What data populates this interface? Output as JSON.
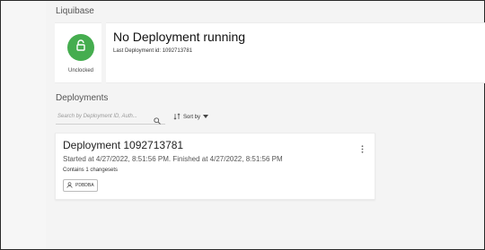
{
  "app": {
    "title": "Liquibase"
  },
  "lock": {
    "status_label": "Unclocked",
    "icon": "unlock-icon",
    "color": "#45ad4f"
  },
  "status": {
    "title": "No Deployment running",
    "last_deployment": "Last Deployment id: 1092713781"
  },
  "deployments": {
    "heading": "Deployments",
    "search_placeholder": "Search by Deployment ID, Auth...",
    "sort_label": "Sort by",
    "items": [
      {
        "title": "Deployment 1092713781",
        "times": "Started at 4/27/2022, 8:51:56 PM. Finished at 4/27/2022, 8:51:56 PM",
        "changesets": "Contains 1 changesets",
        "author": "PDBDBA"
      }
    ]
  }
}
